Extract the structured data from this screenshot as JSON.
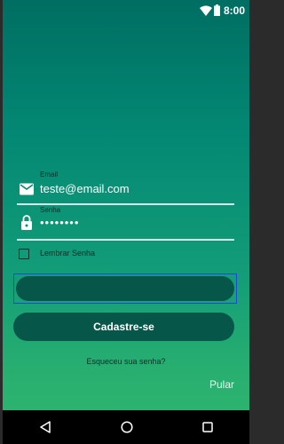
{
  "status_bar": {
    "time": "8:00",
    "icons": [
      "wifi-icon",
      "battery-icon"
    ]
  },
  "login_form": {
    "email": {
      "label": "Email",
      "value": "teste@email.com",
      "icon": "email-icon"
    },
    "password": {
      "label": "Senha",
      "value": "••••••••",
      "icon": "lock-icon"
    },
    "remember": {
      "label": "Lembrar Senha",
      "checked": false
    },
    "login_button_label": "",
    "signup_button_label": "Cadastre-se",
    "forgot_password": "Esqueceu sua senha?",
    "skip": "Pular"
  },
  "nav_bar": {
    "icons": [
      "back-icon",
      "home-icon",
      "recents-icon"
    ]
  },
  "colors": {
    "gradient_top": "#006e62",
    "gradient_bottom": "#2fb56d",
    "button": "#06574a",
    "focus_outline": "#1f49d8"
  }
}
